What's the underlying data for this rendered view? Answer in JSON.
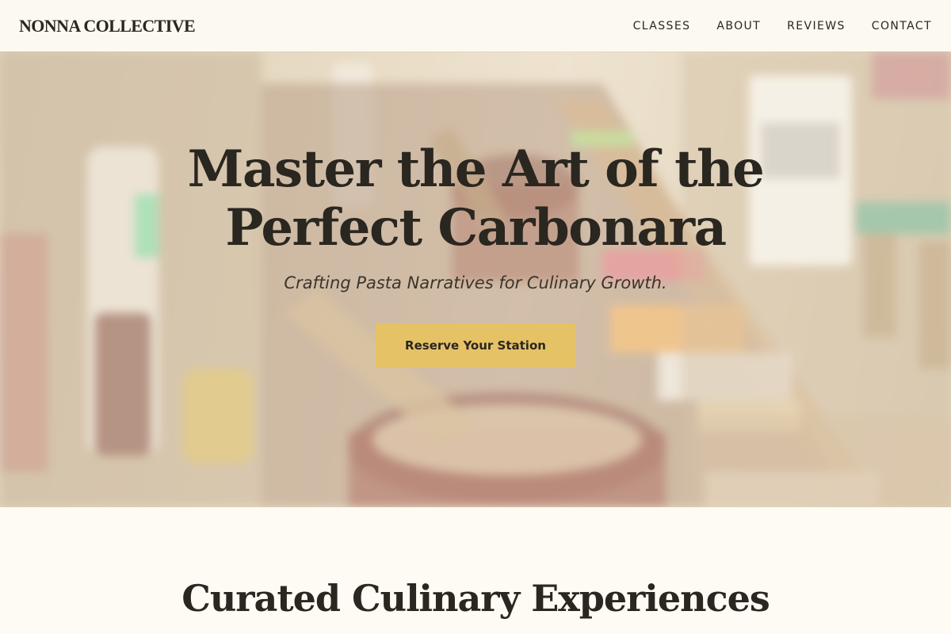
{
  "header": {
    "logo": "NONNA COLLECTIVE",
    "nav": [
      {
        "label": "CLASSES"
      },
      {
        "label": "ABOUT"
      },
      {
        "label": "REVIEWS"
      },
      {
        "label": "CONTACT"
      }
    ]
  },
  "hero": {
    "title": "Master the Art of the Perfect Carbonara",
    "subtitle": "Crafting Pasta Narratives for Culinary Growth.",
    "cta_label": "Reserve Your Station"
  },
  "section": {
    "title": "Curated Culinary Experiences"
  },
  "colors": {
    "background": "#fdfbf3",
    "accent": "#e6c266",
    "text": "#2a2620"
  }
}
